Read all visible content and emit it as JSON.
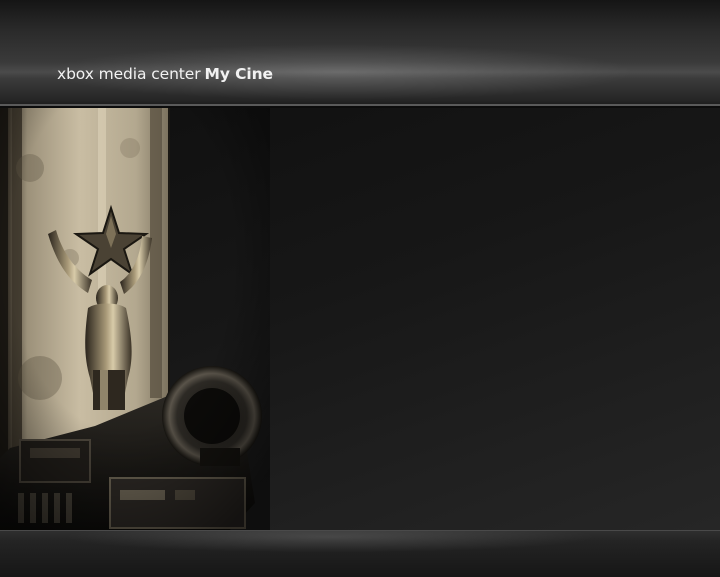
{
  "header": {
    "app_name": "xbox media center",
    "section_title": "My Cine"
  },
  "hero_image": {
    "subject": "award-statuette-and-film-camera"
  },
  "colors": {
    "title_text": "#f2f2f2",
    "background": "#0c0c0c",
    "sepia_light": "#cbbfa4"
  }
}
